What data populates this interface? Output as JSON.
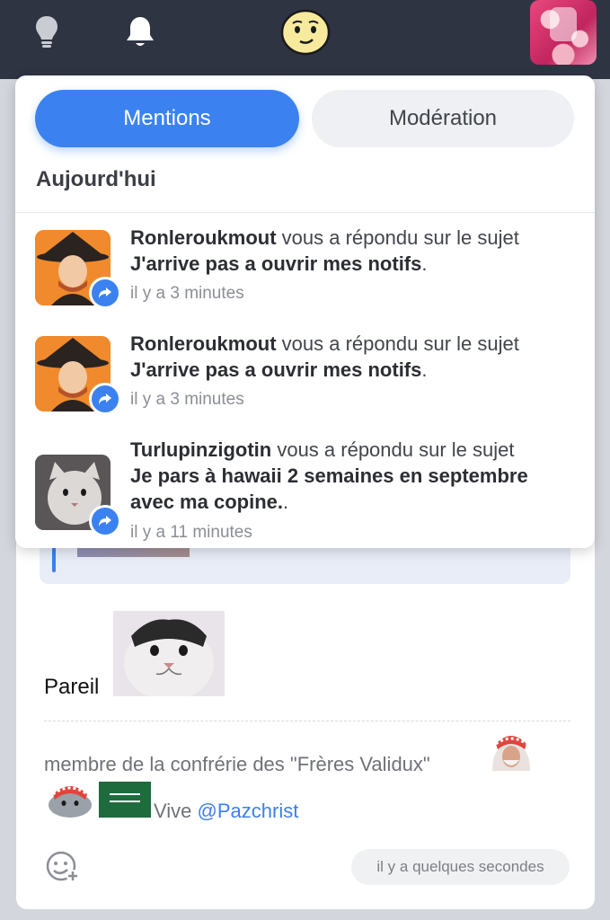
{
  "topbar": {
    "icons": [
      "lightbulb-icon",
      "bell-icon",
      "smiley-logo-icon",
      "user-avatar"
    ],
    "background": "#2f3443"
  },
  "notifications": {
    "tabs": [
      {
        "label": "Mentions",
        "active": true
      },
      {
        "label": "Modération",
        "active": false
      }
    ],
    "section_title": "Aujourd'hui",
    "items": [
      {
        "user": "Ronleroukmout",
        "action": " vous a répondu sur le sujet ",
        "subject": "J'arrive pas a ouvrir mes notifs",
        "suffix": ".",
        "time": "il y a 3 minutes"
      },
      {
        "user": "Ronleroukmout",
        "action": " vous a répondu sur le sujet ",
        "subject": "J'arrive pas a ouvrir mes notifs",
        "suffix": ".",
        "time": "il y a 3 minutes"
      },
      {
        "user": "Turlupinzigotin",
        "action": " vous a répondu sur le sujet ",
        "subject": "Je pars à hawaii 2 semaines en septembre avec ma copine.",
        "suffix": ".",
        "time": "il y a 11 minutes"
      }
    ],
    "accent": "#3b82f0"
  },
  "post": {
    "body_text": "Pareil",
    "signature_line1": "membre de la confrérie des \"Frères Validux\"",
    "signature_line2_prefix": "Vive ",
    "signature_mention": "@Pazchrist",
    "timestamp": "il y a quelques secondes"
  }
}
